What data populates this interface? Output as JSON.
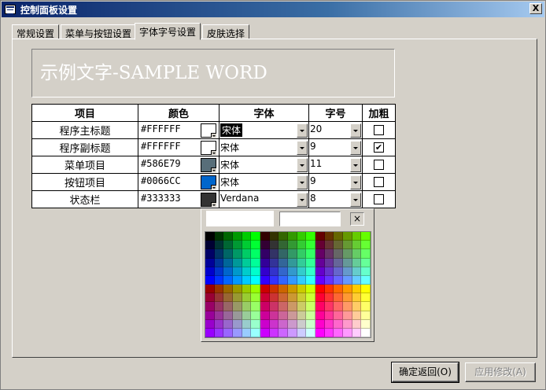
{
  "window": {
    "title": "控制面板设置",
    "close_symbol": "X"
  },
  "tabs": [
    "常规设置",
    "菜单与按钮设置",
    "字体字号设置",
    "皮肤选择"
  ],
  "active_tab": 2,
  "sample_text": "示例文字-SAMPLE WORD",
  "table": {
    "headers": {
      "item": "项目",
      "color": "颜色",
      "font": "字体",
      "size": "字号",
      "bold": "加粗"
    },
    "rows": [
      {
        "item": "程序主标题",
        "hex": "#FFFFFF",
        "swatch": "#ffffff",
        "font": "宋体",
        "size": "20",
        "bold": false,
        "font_selected": true
      },
      {
        "item": "程序副标题",
        "hex": "#FFFFFF",
        "swatch": "#ffffff",
        "font": "宋体",
        "size": "9",
        "bold": true,
        "font_selected": false
      },
      {
        "item": "菜单项目",
        "hex": "#586E79",
        "swatch": "#586e79",
        "font": "宋体",
        "size": "11",
        "bold": false,
        "font_selected": false
      },
      {
        "item": "按钮项目",
        "hex": "#0066CC",
        "swatch": "#0066cc",
        "font": "宋体",
        "size": "9",
        "bold": false,
        "font_selected": false
      },
      {
        "item": "状态栏",
        "hex": "#333333",
        "swatch": "#333333",
        "font": "Verdana",
        "size": "8",
        "bold": false,
        "font_selected": false
      }
    ],
    "check_symbol": "✔"
  },
  "color_picker": {
    "close_symbol": "×"
  },
  "buttons": {
    "ok": "确定返回(O)",
    "apply": "应用修改(A)"
  }
}
